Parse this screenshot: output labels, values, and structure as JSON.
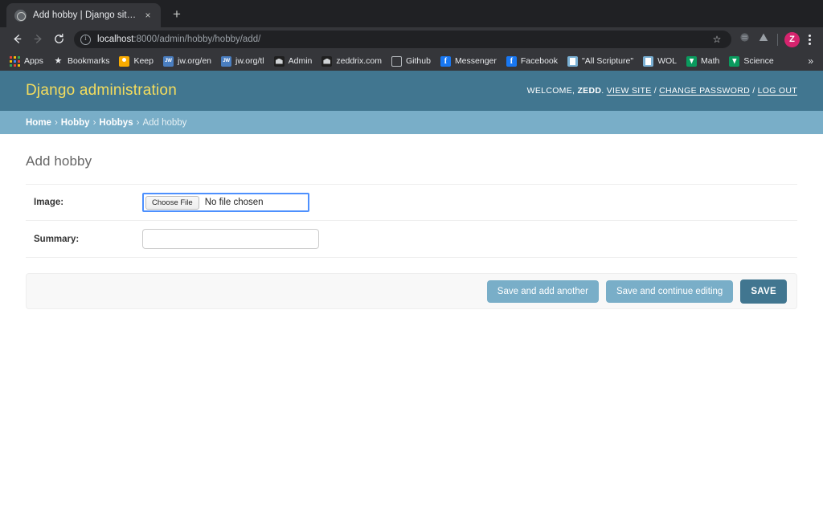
{
  "browser": {
    "tab": {
      "title": "Add hobby | Django site admin",
      "favicon": "globe-icon",
      "close_label": "×"
    },
    "new_tab_label": "+",
    "nav": {
      "back_label": "←",
      "forward_label": "→",
      "reload_label": "⟳"
    },
    "omnibox": {
      "security_icon": "info-circle-icon",
      "url_host": "localhost",
      "url_path": ":8000/admin/hobby/hobby/add/",
      "bookmark_star_label": "☆"
    },
    "toolbar_right": {
      "extension1": "extension-icon",
      "extension2": "drive-icon",
      "avatar_initial": "Z",
      "menu_label": "kebab-menu-icon"
    },
    "bookmarks": [
      {
        "label": "Apps",
        "icon": "apps-grid-icon"
      },
      {
        "label": "Bookmarks",
        "icon": "star-icon"
      },
      {
        "label": "Keep",
        "icon": "keep-icon"
      },
      {
        "label": "jw.org/en",
        "icon": "jw-icon"
      },
      {
        "label": "jw.org/tl",
        "icon": "jw-icon"
      },
      {
        "label": "Admin",
        "icon": "house-icon"
      },
      {
        "label": "zeddrix.com",
        "icon": "house-icon"
      },
      {
        "label": "Github",
        "icon": "github-icon"
      },
      {
        "label": "Messenger",
        "icon": "facebook-icon"
      },
      {
        "label": "Facebook",
        "icon": "facebook-icon"
      },
      {
        "label": "\"All Scripture\"",
        "icon": "document-icon"
      },
      {
        "label": "WOL",
        "icon": "document-icon"
      },
      {
        "label": "Math",
        "icon": "green-badge-icon"
      },
      {
        "label": "Science",
        "icon": "green-badge-icon"
      }
    ],
    "bookmarks_overflow_label": "»"
  },
  "admin": {
    "brand": "Django administration",
    "user": {
      "welcome_prefix": "WELCOME,",
      "username": "ZEDD",
      "welcome_suffix": ".",
      "view_site": "VIEW SITE",
      "separator": "/",
      "change_password": "CHANGE PASSWORD",
      "log_out": "LOG OUT"
    },
    "breadcrumbs": {
      "items": [
        {
          "label": "Home",
          "current": false
        },
        {
          "label": "Hobby",
          "current": false
        },
        {
          "label": "Hobbys",
          "current": false
        },
        {
          "label": "Add hobby",
          "current": true
        }
      ],
      "separator": "›"
    },
    "page_title": "Add hobby",
    "form": {
      "fields": [
        {
          "label": "Image:",
          "type": "file",
          "choose_button": "Choose File",
          "file_status": "No file chosen",
          "focused": true
        },
        {
          "label": "Summary:",
          "type": "text",
          "value": "",
          "placeholder": ""
        }
      ]
    },
    "submit_row": {
      "save_and_add_another": "Save and add another",
      "save_and_continue": "Save and continue editing",
      "save": "SAVE"
    },
    "colors": {
      "header_bg": "#417690",
      "breadcrumb_bg": "#79aec8",
      "brand_text": "#f5dd5d",
      "button_bg": "#79aec8",
      "button_default_bg": "#417690",
      "focus_ring": "#4d90fe"
    }
  }
}
